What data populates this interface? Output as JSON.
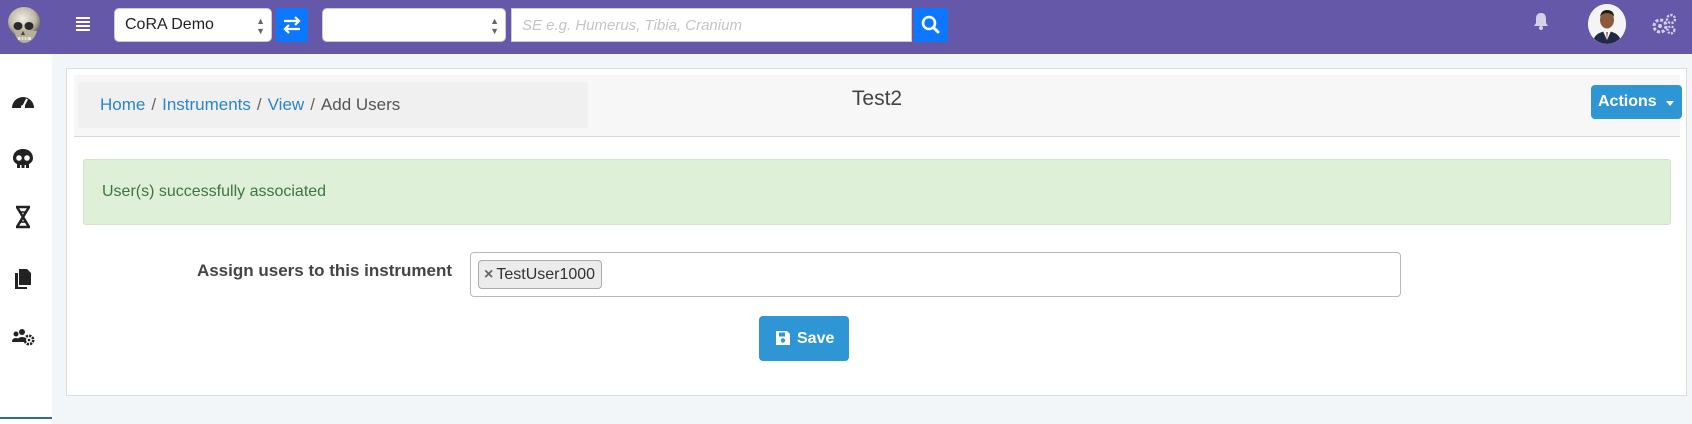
{
  "navbar": {
    "logo_icon": "skull-logo",
    "menu_icon": "menu-icon",
    "db_select": {
      "value": "CoRA Demo",
      "icon": "updown-arrows-icon"
    },
    "swap_icon": "swap-arrows-icon",
    "bone_select": {
      "value": ""
    },
    "search": {
      "placeholder": "SE e.g. Humerus, Tibia, Cranium",
      "value": ""
    },
    "search_icon": "search-icon",
    "bell_icon": "bell-icon",
    "avatar_icon": "user-avatar",
    "settings_icon": "gears-icon",
    "color": "#6558a8",
    "accent": "#0d78ff"
  },
  "sidebar": {
    "items": [
      {
        "icon": "dashboard-icon"
      },
      {
        "icon": "skull-icon"
      },
      {
        "icon": "dna-icon"
      },
      {
        "icon": "copy-icon"
      },
      {
        "icon": "users-cog-icon"
      }
    ]
  },
  "breadcrumb": {
    "home": "Home",
    "instruments": "Instruments",
    "view": "View",
    "current": "Add Users",
    "separator": "/"
  },
  "page": {
    "title": "Test2",
    "actions_label": "Actions"
  },
  "alert": {
    "message": "User(s) successfully associated",
    "color": "#dff0d8"
  },
  "form": {
    "label": "Assign users to this instrument",
    "tags": [
      {
        "remove": "×",
        "label": "TestUser1000"
      }
    ],
    "save_label": "Save",
    "save_icon": "floppy-icon",
    "button_color": "#2f96d6"
  }
}
